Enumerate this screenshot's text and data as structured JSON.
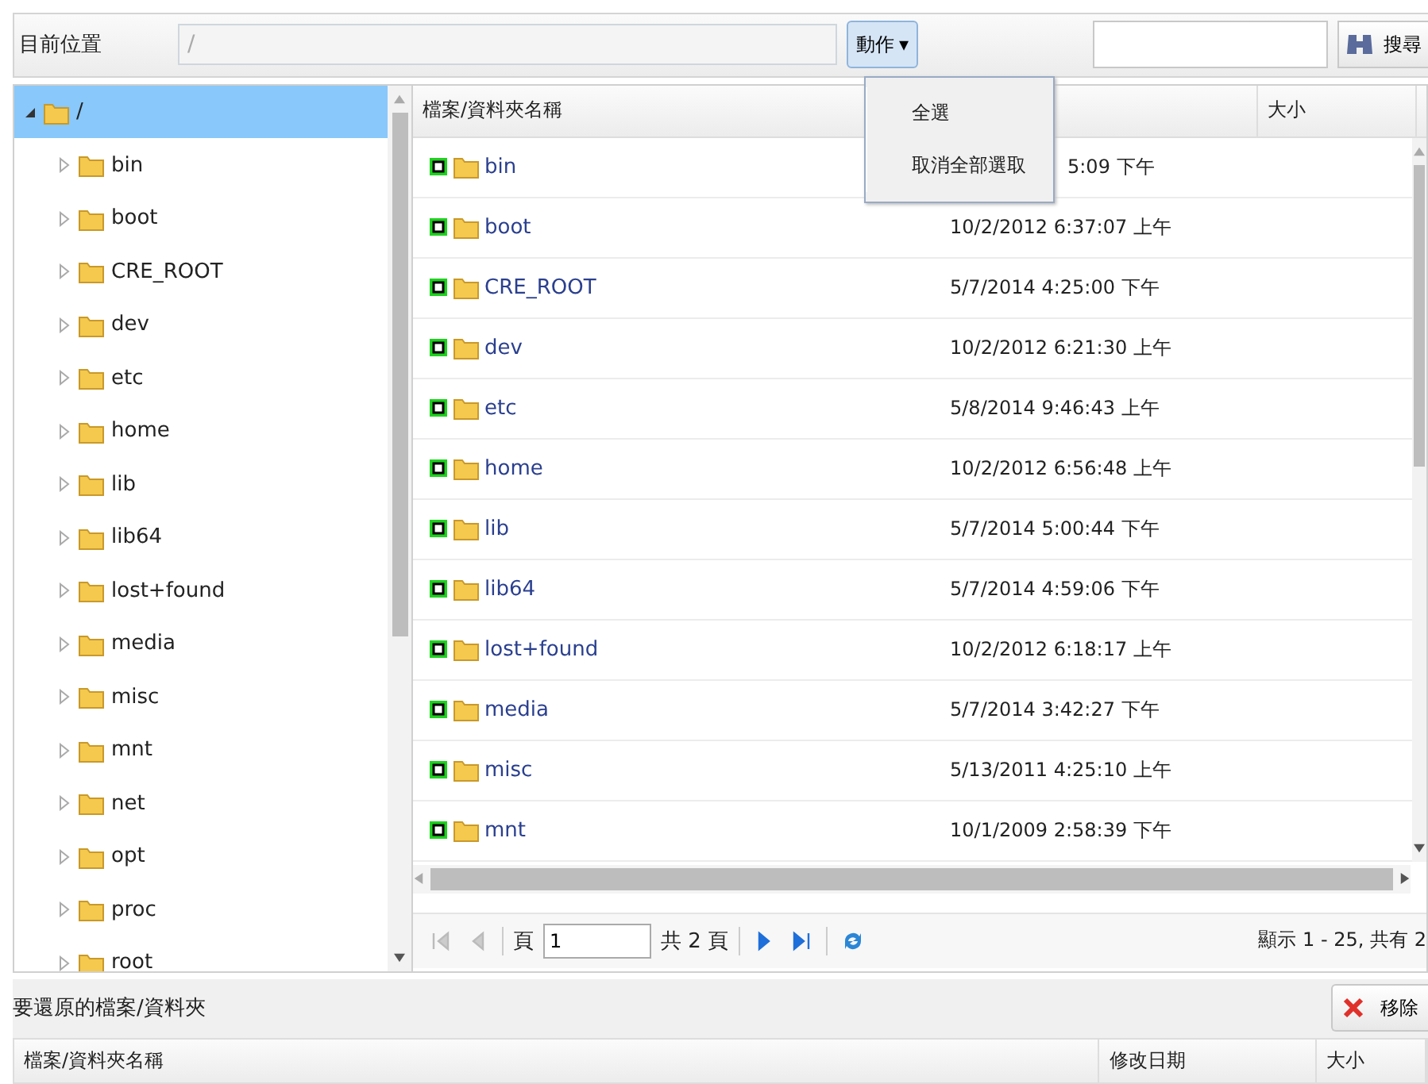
{
  "toolbar": {
    "location_label": "目前位置",
    "path_value": "/",
    "action_button": {
      "label": "動作",
      "caret": "▾",
      "menu_open": true
    },
    "search_button": "搜尋"
  },
  "action_menu": [
    {
      "label": "全選"
    },
    {
      "label": "取消全部選取"
    }
  ],
  "tree": {
    "label": "/",
    "expanded": true,
    "selected": true,
    "children": [
      {
        "label": "bin",
        "expanded": false,
        "selected": false
      },
      {
        "label": "boot",
        "expanded": false,
        "selected": false
      },
      {
        "label": "CRE_ROOT",
        "expanded": false,
        "selected": false
      },
      {
        "label": "dev",
        "expanded": false,
        "selected": false
      },
      {
        "label": "etc",
        "expanded": false,
        "selected": false
      },
      {
        "label": "home",
        "expanded": false,
        "selected": false
      },
      {
        "label": "lib",
        "expanded": false,
        "selected": false
      },
      {
        "label": "lib64",
        "expanded": false,
        "selected": false
      },
      {
        "label": "lost+found",
        "expanded": false,
        "selected": false
      },
      {
        "label": "media",
        "expanded": false,
        "selected": false
      },
      {
        "label": "misc",
        "expanded": false,
        "selected": false
      },
      {
        "label": "mnt",
        "expanded": false,
        "selected": false
      },
      {
        "label": "net",
        "expanded": false,
        "selected": false
      },
      {
        "label": "opt",
        "expanded": false,
        "selected": false
      },
      {
        "label": "proc",
        "expanded": false,
        "selected": false
      },
      {
        "label": "root",
        "expanded": false,
        "selected": false
      }
    ]
  },
  "file_grid": {
    "columns": [
      "檔案/資料夾名稱",
      "",
      "大小"
    ],
    "rows": [
      {
        "name": "bin",
        "modified": "5:09 下午",
        "partly_hidden": true
      },
      {
        "name": "boot",
        "modified": "10/2/2012 6:37:07 上午",
        "partly_hidden": false
      },
      {
        "name": "CRE_ROOT",
        "modified": "5/7/2014 4:25:00 下午",
        "partly_hidden": false
      },
      {
        "name": "dev",
        "modified": "10/2/2012 6:21:30 上午",
        "partly_hidden": false
      },
      {
        "name": "etc",
        "modified": "5/8/2014 9:46:43 上午",
        "partly_hidden": false
      },
      {
        "name": "home",
        "modified": "10/2/2012 6:56:48 上午",
        "partly_hidden": false
      },
      {
        "name": "lib",
        "modified": "5/7/2014 5:00:44 下午",
        "partly_hidden": false
      },
      {
        "name": "lib64",
        "modified": "5/7/2014 4:59:06 下午",
        "partly_hidden": false
      },
      {
        "name": "lost+found",
        "modified": "10/2/2012 6:18:17 上午",
        "partly_hidden": false
      },
      {
        "name": "media",
        "modified": "5/7/2014 3:42:27 下午",
        "partly_hidden": false
      },
      {
        "name": "misc",
        "modified": "5/13/2011 4:25:10 上午",
        "partly_hidden": false
      },
      {
        "name": "mnt",
        "modified": "10/1/2009 2:58:39 下午",
        "partly_hidden": false
      }
    ]
  },
  "pager": {
    "nav": [
      {
        "kind": "first",
        "disabled": true
      },
      {
        "kind": "prev",
        "disabled": true
      }
    ],
    "page_label": "頁",
    "page": "1",
    "total": "共 2 頁",
    "nav_after": [
      {
        "kind": "next",
        "disabled": false
      },
      {
        "kind": "last",
        "disabled": false
      }
    ],
    "info": "顯示 1 - 25, 共有 2"
  },
  "restore": {
    "title": "要還原的檔案/資料夾",
    "remove_button": "移除",
    "columns": [
      "檔案/資料夾名稱",
      "修改日期",
      "大小"
    ]
  }
}
